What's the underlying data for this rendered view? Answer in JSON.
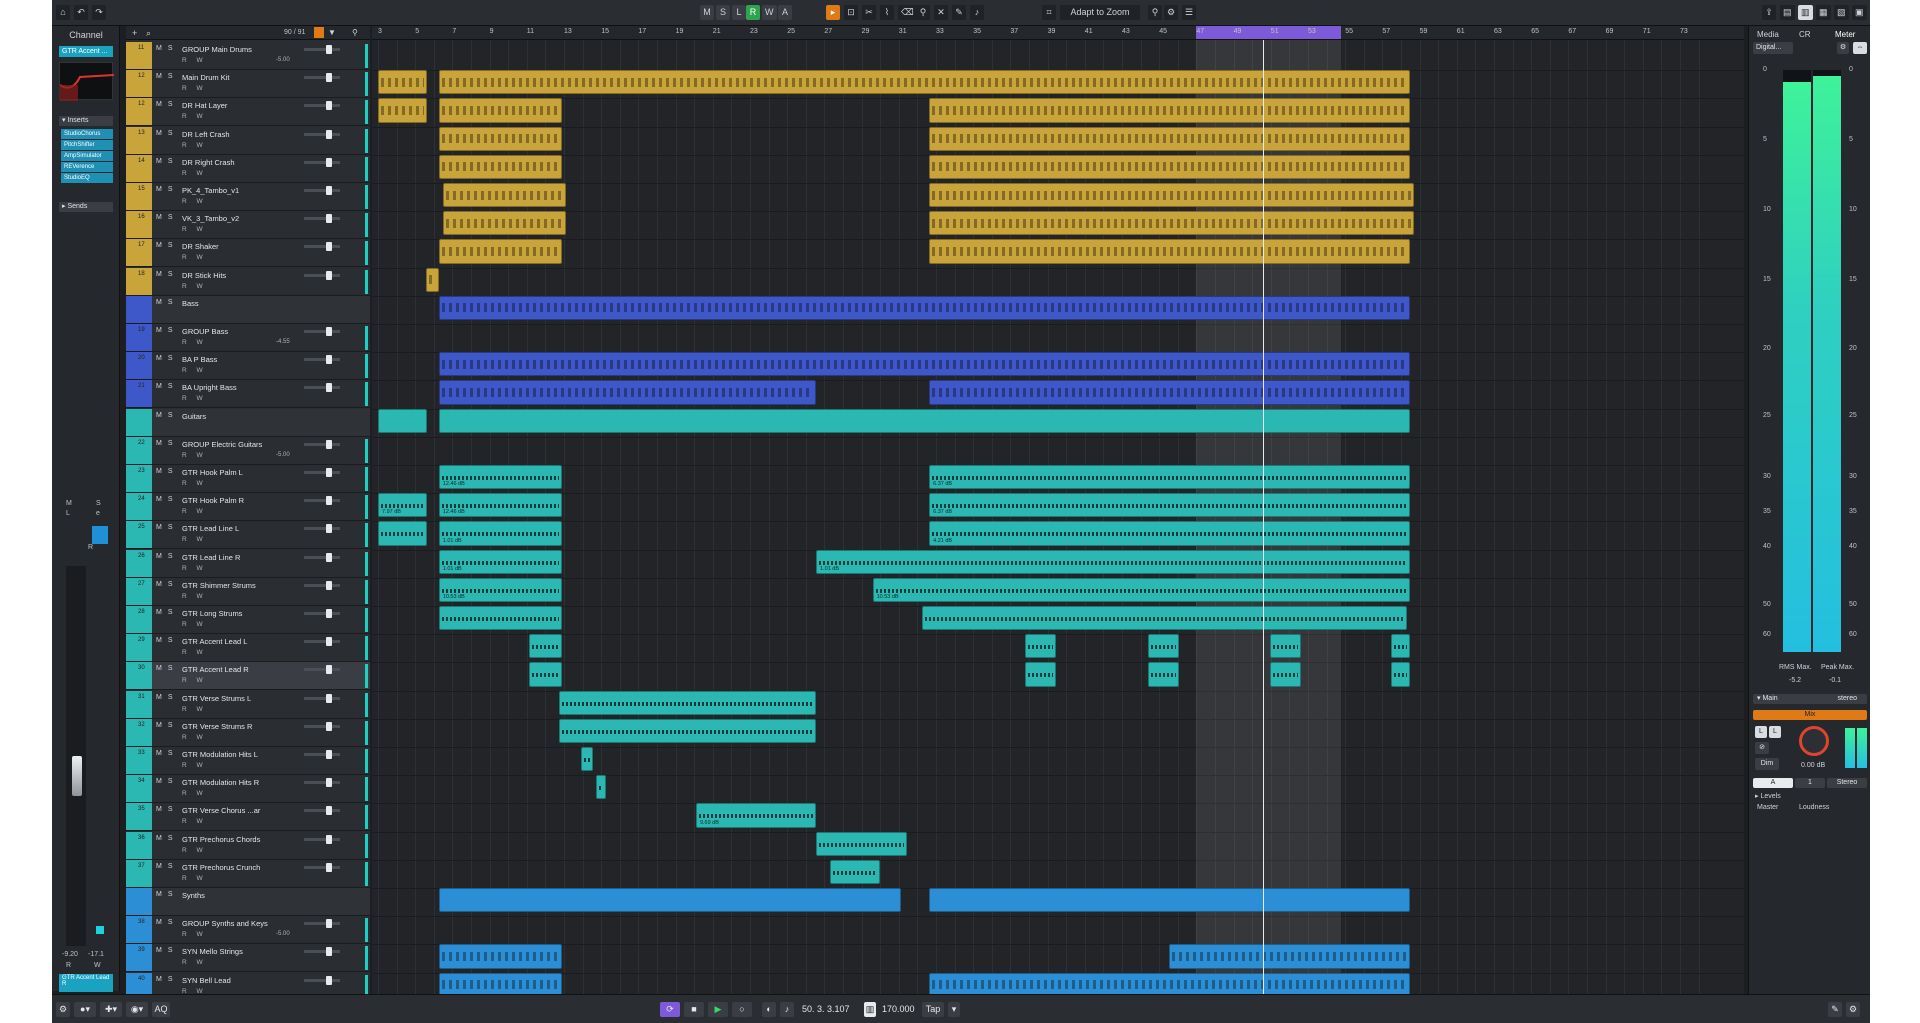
{
  "toolbar": {
    "home_icon": "home-icon",
    "buttons": [
      "M",
      "S",
      "L",
      "R",
      "W",
      "A"
    ],
    "zoom_label": "Adapt to Zoom"
  },
  "left_panel": {
    "title": "Channel",
    "channel_name": "GTR Accent ...",
    "inserts_label": "Inserts",
    "inserts": [
      "StudioChorus",
      "PitchShifter",
      "AmpSimulator",
      "REVerence",
      "StudioEQ"
    ],
    "sends_label": "Sends",
    "values": [
      "-9.20",
      "-17.1"
    ],
    "bottom_channel": "GTR Accent Lead R"
  },
  "track_header_counter": "90 / 91",
  "tracks": [
    {
      "num": "11",
      "name": "GROUP Main Drums",
      "rw": "R W",
      "val": "-5.00",
      "color": "#c9a43a"
    },
    {
      "num": "12",
      "name": "Main Drum Kit",
      "rw": "R W",
      "val": "",
      "color": "#c9a43a"
    },
    {
      "num": "12",
      "name": "DR Hat Layer",
      "rw": "R W",
      "val": "",
      "color": "#c9a43a"
    },
    {
      "num": "13",
      "name": "DR Left Crash",
      "rw": "R W",
      "val": "",
      "color": "#c9a43a"
    },
    {
      "num": "14",
      "name": "DR Right Crash",
      "rw": "R W",
      "val": "",
      "color": "#c9a43a"
    },
    {
      "num": "15",
      "name": "PK_4_Tambo_v1",
      "rw": "R W",
      "val": "",
      "color": "#c9a43a"
    },
    {
      "num": "16",
      "name": "VK_3_Tambo_v2",
      "rw": "R W",
      "val": "",
      "color": "#c9a43a"
    },
    {
      "num": "17",
      "name": "DR Shaker",
      "rw": "R W",
      "val": "",
      "color": "#c9a43a"
    },
    {
      "num": "18",
      "name": "DR Stick Hits",
      "rw": "R W",
      "val": "",
      "color": "#c9a43a"
    },
    {
      "num": "",
      "name": "Bass",
      "rw": "",
      "val": "",
      "color": "#3f58c9",
      "folder": true
    },
    {
      "num": "19",
      "name": "GROUP Bass",
      "rw": "R W",
      "val": "-4.55",
      "color": "#3f58c9"
    },
    {
      "num": "20",
      "name": "BA P Bass",
      "rw": "R W",
      "val": "",
      "color": "#3f58c9"
    },
    {
      "num": "21",
      "name": "BA Upright Bass",
      "rw": "R W",
      "val": "",
      "color": "#3f58c9"
    },
    {
      "num": "",
      "name": "Guitars",
      "rw": "",
      "val": "",
      "color": "#2bb8b3",
      "folder": true
    },
    {
      "num": "22",
      "name": "GROUP Electric Guitars",
      "rw": "R W",
      "val": "-5.00",
      "color": "#2bb8b3"
    },
    {
      "num": "23",
      "name": "GTR Hook Palm L",
      "rw": "R W",
      "val": "",
      "color": "#2bb8b3"
    },
    {
      "num": "24",
      "name": "GTR Hook Palm R",
      "rw": "R W",
      "val": "",
      "color": "#2bb8b3"
    },
    {
      "num": "25",
      "name": "GTR Lead Line L",
      "rw": "R W",
      "val": "",
      "color": "#2bb8b3"
    },
    {
      "num": "26",
      "name": "GTR Lead Line R",
      "rw": "R W",
      "val": "",
      "color": "#2bb8b3"
    },
    {
      "num": "27",
      "name": "GTR Shimmer Strums",
      "rw": "R W",
      "val": "",
      "color": "#2bb8b3"
    },
    {
      "num": "28",
      "name": "GTR Long Strums",
      "rw": "R W",
      "val": "",
      "color": "#2bb8b3"
    },
    {
      "num": "29",
      "name": "GTR Accent Lead L",
      "rw": "R W",
      "val": "",
      "color": "#2bb8b3"
    },
    {
      "num": "30",
      "name": "GTR Accent Lead R",
      "rw": "R W",
      "val": "",
      "color": "#2bb8b3",
      "selected": true
    },
    {
      "num": "31",
      "name": "GTR Verse Strums L",
      "rw": "R W",
      "val": "",
      "color": "#2bb8b3"
    },
    {
      "num": "32",
      "name": "GTR Verse Strums R",
      "rw": "R W",
      "val": "",
      "color": "#2bb8b3"
    },
    {
      "num": "33",
      "name": "GTR Modulation Hits L",
      "rw": "R W",
      "val": "",
      "color": "#2bb8b3"
    },
    {
      "num": "34",
      "name": "GTR Modulation Hits R",
      "rw": "R W",
      "val": "",
      "color": "#2bb8b3"
    },
    {
      "num": "35",
      "name": "GTR Verse Chorus ...ar",
      "rw": "R W",
      "val": "",
      "color": "#2bb8b3"
    },
    {
      "num": "36",
      "name": "GTR Prechorus Chords",
      "rw": "R W",
      "val": "",
      "color": "#2bb8b3"
    },
    {
      "num": "37",
      "name": "GTR Prechorus Crunch",
      "rw": "R W",
      "val": "",
      "color": "#2bb8b3"
    },
    {
      "num": "",
      "name": "Synths",
      "rw": "",
      "val": "",
      "color": "#2c8fd6",
      "folder": true
    },
    {
      "num": "38",
      "name": "GROUP Synths and Keys",
      "rw": "R W",
      "val": "-5.00",
      "color": "#2c8fd6"
    },
    {
      "num": "39",
      "name": "SYN Mello Strings",
      "rw": "R W",
      "val": "",
      "color": "#2c8fd6"
    },
    {
      "num": "40",
      "name": "SYN Bell Lead",
      "rw": "R W",
      "val": "",
      "color": "#2c8fd6"
    }
  ],
  "ruler_bars": [
    "3",
    "5",
    "7",
    "9",
    "11",
    "13",
    "15",
    "17",
    "19",
    "21",
    "23",
    "25",
    "27",
    "29",
    "31",
    "33",
    "35",
    "37",
    "39",
    "41",
    "43",
    "45",
    "47",
    "49",
    "51",
    "53",
    "55",
    "57",
    "59",
    "61",
    "63",
    "65",
    "67",
    "69",
    "71",
    "73"
  ],
  "events": [
    {
      "row": 1,
      "type": "drum midi",
      "from": 0.0,
      "to": 0.035
    },
    {
      "row": 1,
      "type": "drum midi",
      "from": 0.043,
      "to": 0.73
    },
    {
      "row": 2,
      "type": "drum midi",
      "from": 0.0,
      "to": 0.035
    },
    {
      "row": 2,
      "type": "drum midi",
      "from": 0.043,
      "to": 0.13
    },
    {
      "row": 2,
      "type": "drum midi",
      "from": 0.39,
      "to": 0.73
    },
    {
      "row": 3,
      "type": "drum midi",
      "from": 0.043,
      "to": 0.13
    },
    {
      "row": 3,
      "type": "drum midi",
      "from": 0.39,
      "to": 0.73
    },
    {
      "row": 4,
      "type": "drum midi",
      "from": 0.043,
      "to": 0.13
    },
    {
      "row": 4,
      "type": "drum midi",
      "from": 0.39,
      "to": 0.73
    },
    {
      "row": 5,
      "type": "drum midi",
      "from": 0.046,
      "to": 0.133
    },
    {
      "row": 5,
      "type": "drum midi",
      "from": 0.39,
      "to": 0.733
    },
    {
      "row": 6,
      "type": "drum midi",
      "from": 0.046,
      "to": 0.133
    },
    {
      "row": 6,
      "type": "drum midi",
      "from": 0.39,
      "to": 0.733
    },
    {
      "row": 7,
      "type": "drum midi",
      "from": 0.043,
      "to": 0.13
    },
    {
      "row": 7,
      "type": "drum midi",
      "from": 0.39,
      "to": 0.73
    },
    {
      "row": 8,
      "type": "drum midi",
      "from": 0.034,
      "to": 0.043
    },
    {
      "row": 9,
      "type": "bass midi",
      "from": 0.043,
      "to": 0.73
    },
    {
      "row": 11,
      "type": "bass midi",
      "from": 0.043,
      "to": 0.73
    },
    {
      "row": 12,
      "type": "bass midi",
      "from": 0.043,
      "to": 0.31
    },
    {
      "row": 12,
      "type": "bass midi",
      "from": 0.39,
      "to": 0.73
    },
    {
      "row": 13,
      "type": "gtr",
      "from": 0.0,
      "to": 0.035
    },
    {
      "row": 13,
      "type": "gtr",
      "from": 0.043,
      "to": 0.73
    },
    {
      "row": 15,
      "type": "gtr wave",
      "from": 0.043,
      "to": 0.13,
      "label": "12.46 dB"
    },
    {
      "row": 15,
      "type": "gtr wave",
      "from": 0.39,
      "to": 0.73,
      "label": "6.37 dB"
    },
    {
      "row": 16,
      "type": "gtr wave",
      "from": 0.0,
      "to": 0.035,
      "label": "7.97 dB"
    },
    {
      "row": 16,
      "type": "gtr wave",
      "from": 0.043,
      "to": 0.13,
      "label": "12.46 dB"
    },
    {
      "row": 16,
      "type": "gtr wave",
      "from": 0.39,
      "to": 0.73,
      "label": "6.37 dB"
    },
    {
      "row": 17,
      "type": "gtr wave",
      "from": 0.0,
      "to": 0.035
    },
    {
      "row": 17,
      "type": "gtr wave",
      "from": 0.043,
      "to": 0.13,
      "label": "1.01 dB"
    },
    {
      "row": 17,
      "type": "gtr wave",
      "from": 0.39,
      "to": 0.73,
      "label": "4.21 dB"
    },
    {
      "row": 18,
      "type": "gtr wave",
      "from": 0.043,
      "to": 0.13,
      "label": "1.01 dB"
    },
    {
      "row": 18,
      "type": "gtr wave",
      "from": 0.31,
      "to": 0.73,
      "label": "1.01 dB"
    },
    {
      "row": 19,
      "type": "gtr wave",
      "from": 0.043,
      "to": 0.13,
      "label": "10.53 dB"
    },
    {
      "row": 19,
      "type": "gtr wave",
      "from": 0.35,
      "to": 0.73,
      "label": "10.53 dB"
    },
    {
      "row": 20,
      "type": "gtr wave",
      "from": 0.043,
      "to": 0.13
    },
    {
      "row": 20,
      "type": "gtr wave",
      "from": 0.385,
      "to": 0.728
    },
    {
      "row": 21,
      "type": "gtr wave",
      "from": 0.107,
      "to": 0.13
    },
    {
      "row": 21,
      "type": "gtr wave",
      "from": 0.458,
      "to": 0.48
    },
    {
      "row": 21,
      "type": "gtr wave",
      "from": 0.545,
      "to": 0.567
    },
    {
      "row": 21,
      "type": "gtr wave",
      "from": 0.631,
      "to": 0.653
    },
    {
      "row": 21,
      "type": "gtr wave",
      "from": 0.717,
      "to": 0.73
    },
    {
      "row": 22,
      "type": "gtr wave",
      "from": 0.107,
      "to": 0.13
    },
    {
      "row": 22,
      "type": "gtr wave",
      "from": 0.458,
      "to": 0.48
    },
    {
      "row": 22,
      "type": "gtr wave",
      "from": 0.545,
      "to": 0.567
    },
    {
      "row": 22,
      "type": "gtr wave",
      "from": 0.631,
      "to": 0.653
    },
    {
      "row": 22,
      "type": "gtr wave",
      "from": 0.717,
      "to": 0.73
    },
    {
      "row": 23,
      "type": "gtr wave",
      "from": 0.128,
      "to": 0.31
    },
    {
      "row": 24,
      "type": "gtr wave",
      "from": 0.128,
      "to": 0.31
    },
    {
      "row": 25,
      "type": "gtr wave",
      "from": 0.144,
      "to": 0.152
    },
    {
      "row": 26,
      "type": "gtr wave",
      "from": 0.154,
      "to": 0.161
    },
    {
      "row": 27,
      "type": "gtr wave",
      "from": 0.225,
      "to": 0.31,
      "label": "9.69 dB"
    },
    {
      "row": 28,
      "type": "gtr wave",
      "from": 0.31,
      "to": 0.374
    },
    {
      "row": 29,
      "type": "gtr wave",
      "from": 0.32,
      "to": 0.355
    },
    {
      "row": 30,
      "type": "syn",
      "from": 0.043,
      "to": 0.37
    },
    {
      "row": 30,
      "type": "syn",
      "from": 0.39,
      "to": 0.73
    },
    {
      "row": 32,
      "type": "syn midi",
      "from": 0.043,
      "to": 0.13
    },
    {
      "row": 32,
      "type": "syn midi",
      "from": 0.56,
      "to": 0.73
    },
    {
      "row": 33,
      "type": "syn midi",
      "from": 0.043,
      "to": 0.13
    },
    {
      "row": 33,
      "type": "syn midi",
      "from": 0.39,
      "to": 0.73
    }
  ],
  "right_panel": {
    "tabs": [
      "Media",
      "CR",
      "Meter"
    ],
    "device_label": "Digital...",
    "scale": [
      "0",
      "5",
      "10",
      "15",
      "20",
      "25",
      "30",
      "35",
      "40",
      "50",
      "60"
    ],
    "meter_levels": [
      0.98,
      0.99
    ],
    "rms_label": "RMS Max.",
    "peak_label": "Peak Max.",
    "rms_value": "-5.2",
    "peak_value": "-0.1",
    "main_label": "Main",
    "stereo_label": "stereo",
    "mix_label": "Mix",
    "dim_label": "Dim",
    "db_value": "0.00 dB",
    "a_label": "A",
    "one_label": "1",
    "stereo2_label": "Stereo",
    "levels_label": "Levels",
    "master_tab": "Master",
    "loudness_tab": "Loudness"
  },
  "transport": {
    "position": "50. 3. 3.107",
    "tempo": "170.000",
    "tap_label": "Tap",
    "aq_label": "AQ"
  }
}
